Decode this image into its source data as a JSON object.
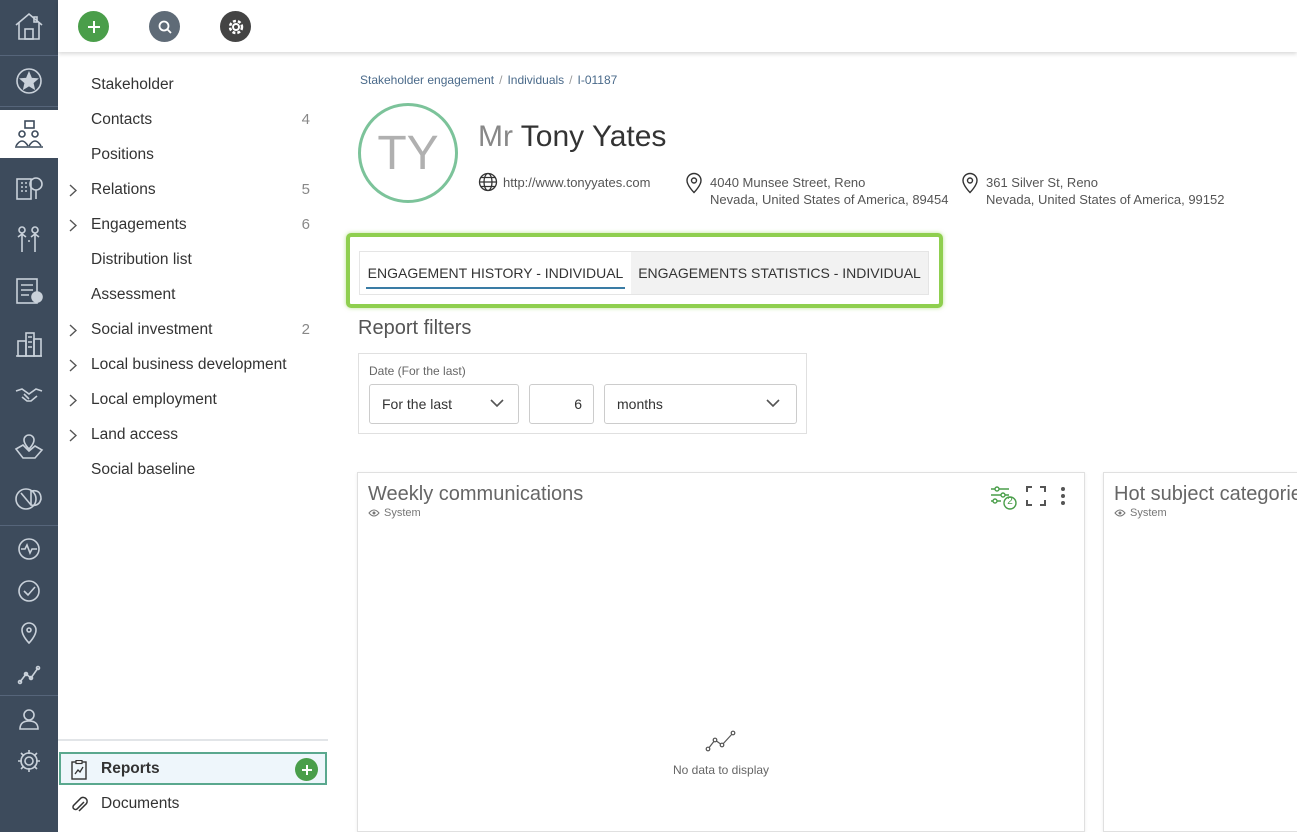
{
  "rail": {
    "icons": [
      "home-icon",
      "star-icon",
      "engagement-icon",
      "building-tree-icon",
      "people-icon",
      "checklist-icon",
      "city-icon",
      "handshake-icon",
      "map-pin-area-icon",
      "leaf-icon",
      "pulse-icon",
      "check-circle-icon",
      "location-icon",
      "trend-icon",
      "user-icon",
      "gear-icon"
    ],
    "active": "engagement-icon"
  },
  "topbar": {
    "add_icon": "plus-icon",
    "search_icon": "search-icon",
    "settings_icon": "gear-icon"
  },
  "nav": {
    "items": [
      {
        "label": "Stakeholder",
        "count": "",
        "expandable": false
      },
      {
        "label": "Contacts",
        "count": "4",
        "expandable": false
      },
      {
        "label": "Positions",
        "count": "",
        "expandable": false
      },
      {
        "label": "Relations",
        "count": "5",
        "expandable": true
      },
      {
        "label": "Engagements",
        "count": "6",
        "expandable": true
      },
      {
        "label": "Distribution list",
        "count": "",
        "expandable": false
      },
      {
        "label": "Assessment",
        "count": "",
        "expandable": false
      },
      {
        "label": "Social investment",
        "count": "2",
        "expandable": true
      },
      {
        "label": "Local business development",
        "count": "",
        "expandable": true
      },
      {
        "label": "Local employment",
        "count": "",
        "expandable": true
      },
      {
        "label": "Land access",
        "count": "",
        "expandable": true
      },
      {
        "label": "Social baseline",
        "count": "",
        "expandable": false
      }
    ],
    "reports_label": "Reports",
    "documents_label": "Documents"
  },
  "breadcrumb": [
    "Stakeholder engagement",
    "Individuals",
    "I-01187"
  ],
  "profile": {
    "initials": "TY",
    "salutation": "Mr",
    "name": "Tony Yates",
    "website": "http://www.tonyyates.com",
    "address1_line1": "4040 Munsee Street, Reno",
    "address1_line2": "Nevada, United States of America, 89454",
    "address2_line1": "361 Silver St, Reno",
    "address2_line2": "Nevada, United States of America, 99152"
  },
  "tabs": [
    {
      "label": "ENGAGEMENT HISTORY - INDIVIDUAL",
      "active": true
    },
    {
      "label": "ENGAGEMENTS STATISTICS - INDIVIDUAL",
      "active": false
    }
  ],
  "filters": {
    "title": "Report filters",
    "date_label": "Date (For the last)",
    "mode": "For the last",
    "amount": "6",
    "unit": "months"
  },
  "widgets": [
    {
      "title": "Weekly communications",
      "visibility": "System",
      "filter_count": "2",
      "empty_text": "No data to display"
    },
    {
      "title": "Hot subject categories",
      "visibility": "System"
    }
  ],
  "colors": {
    "rail": "#3d4b5c",
    "accent_green": "#4a9e4a",
    "highlight": "#8fcf4f",
    "tab_underline": "#3a7ca5"
  }
}
